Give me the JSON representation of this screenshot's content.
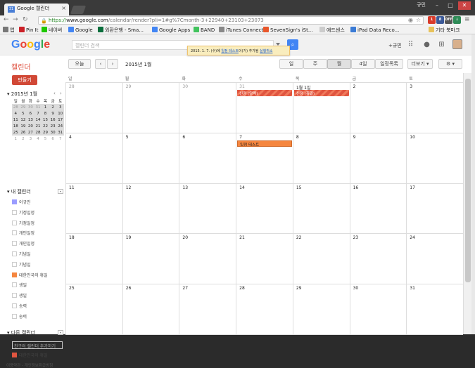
{
  "browser": {
    "tab_title": "Google 캘린더",
    "tab_favicon": "31",
    "user_badge": "규민",
    "url_https": "https://",
    "url_host": "www.google.com",
    "url_rest": "/calendar/render?pli=1#g%7Cmonth-3+22940+23103+23073",
    "extensions": [
      {
        "name": "ext-1-icon",
        "label": "1",
        "color": "#d83a2a"
      },
      {
        "name": "ext-2-icon",
        "label": "8",
        "color": "#3b5998"
      },
      {
        "name": "ext-3-icon",
        "label": "OFF",
        "color": "#555555"
      },
      {
        "name": "ext-4-icon",
        "label": "↓",
        "color": "#2e8b57"
      }
    ],
    "bookmarks": [
      {
        "label": "앱",
        "color": "#777777"
      },
      {
        "label": "Pin It",
        "color": "#cb2027"
      },
      {
        "label": "네이버",
        "color": "#1ec800"
      },
      {
        "label": "Google",
        "color": "#4285f4"
      },
      {
        "label": "외환은행 - Sma...",
        "color": "#0a6e3c"
      },
      {
        "label": "Google Apps",
        "color": "#4285f4"
      },
      {
        "label": "BAND",
        "color": "#41c35d"
      },
      {
        "label": "iTunes Connect",
        "color": "#888888"
      },
      {
        "label": "SevenSign's iSt...",
        "color": "#e8562a"
      },
      {
        "label": "애드센스",
        "color": "#cccccc"
      },
      {
        "label": "iPad Data Reco...",
        "color": "#3a7bd5"
      }
    ],
    "other_bookmarks": "기타 북마크"
  },
  "gbar": {
    "logo": "Google",
    "search_placeholder": "캘린더 검색",
    "plus_user": "+규민",
    "toast_text": "2015. 1. 7. (수)에 ",
    "toast_event": "일정 테스트",
    "toast_suffix": "이(가) 추가됨 ",
    "toast_undo": "실행취소"
  },
  "header": {
    "app_name": "캘린더",
    "today": "오늘",
    "prev": "‹",
    "next": "›",
    "date_range": "2015년 1월",
    "views": [
      "일",
      "주",
      "월",
      "4일",
      "일정목록"
    ],
    "active_view": "월",
    "more": "더보기 ▾",
    "settings": "⚙ ▾"
  },
  "sidebar": {
    "create": "만들기",
    "mini_title": "▾ 2015년 1월",
    "mini_dows": [
      "일",
      "월",
      "화",
      "수",
      "목",
      "금",
      "토"
    ],
    "mini_weeks": [
      [
        "28",
        "29",
        "30",
        "31",
        "1",
        "2",
        "3"
      ],
      [
        "4",
        "5",
        "6",
        "7",
        "8",
        "9",
        "10"
      ],
      [
        "11",
        "12",
        "13",
        "14",
        "15",
        "16",
        "17"
      ],
      [
        "18",
        "19",
        "20",
        "21",
        "22",
        "23",
        "24"
      ],
      [
        "25",
        "26",
        "27",
        "28",
        "29",
        "30",
        "31"
      ],
      [
        "1",
        "2",
        "3",
        "4",
        "5",
        "6",
        "7"
      ]
    ],
    "my_calendars_title": "▾ 내 캘린더",
    "my_calendars": [
      {
        "label": "이규민",
        "color": "#9a9cff"
      },
      {
        "label": "기정일정",
        "color": ""
      },
      {
        "label": "가정일정",
        "color": ""
      },
      {
        "label": "개인일정",
        "color": ""
      },
      {
        "label": "개인일정",
        "color": ""
      },
      {
        "label": "기념일",
        "color": ""
      },
      {
        "label": "기념일",
        "color": ""
      },
      {
        "label": "대한민국의 휴일",
        "color": "#f5863f"
      },
      {
        "label": "생일",
        "color": ""
      },
      {
        "label": "생일",
        "color": ""
      },
      {
        "label": "송력",
        "color": ""
      },
      {
        "label": "송력",
        "color": ""
      }
    ],
    "other_calendars_title": "▾ 다른 캘린더",
    "add_friend_placeholder": "친구의 캘린더 추가하기",
    "other_calendars": [
      {
        "label": "대한민국의 휴일",
        "color": "#e05540"
      }
    ],
    "footer": "이용약관 - 개인정보취급방침"
  },
  "calendar": {
    "dows": [
      "일",
      "월",
      "화",
      "수",
      "목",
      "금",
      "토"
    ],
    "weeks": [
      [
        "28",
        "29",
        "30",
        "31",
        "1월 1일",
        "2",
        "3"
      ],
      [
        "4",
        "5",
        "6",
        "7",
        "8",
        "9",
        "10"
      ],
      [
        "11",
        "12",
        "13",
        "14",
        "15",
        "16",
        "17"
      ],
      [
        "18",
        "19",
        "20",
        "21",
        "22",
        "23",
        "24"
      ],
      [
        "25",
        "26",
        "27",
        "28",
        "29",
        "30",
        "31"
      ]
    ],
    "dim_first_week_count": 4,
    "events": [
      {
        "week": 0,
        "day": 3,
        "label": "신정 (양력)",
        "kind": "holiday"
      },
      {
        "week": 0,
        "day": 4,
        "label": "신정 (휴일)",
        "kind": "holiday"
      },
      {
        "week": 1,
        "day": 3,
        "label": "일정 테스트",
        "kind": "task"
      }
    ]
  }
}
